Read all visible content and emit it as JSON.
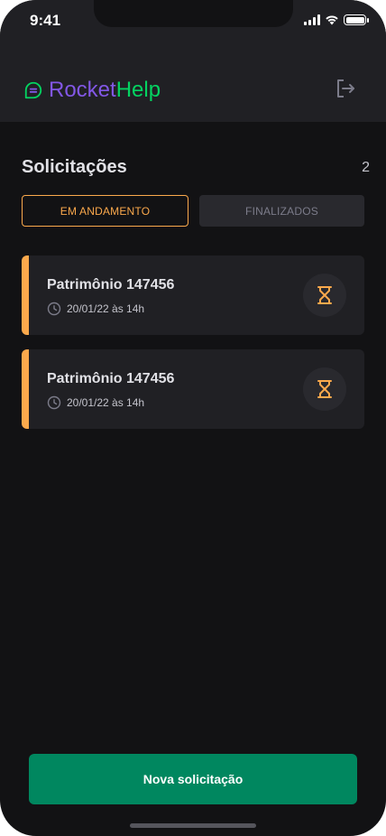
{
  "status_bar": {
    "time": "9:41"
  },
  "header": {
    "logo_part1": "Rocket",
    "logo_part2": "Help",
    "logout_icon": "logout-icon"
  },
  "main": {
    "title": "Solicitações",
    "count": "2",
    "tabs": [
      {
        "label": "EM ANDAMENTO",
        "active": true
      },
      {
        "label": "FINALIZADOS",
        "active": false
      }
    ],
    "orders": [
      {
        "title": "Patrimônio 147456",
        "when": "20/01/22 às 14h",
        "status_icon": "hourglass-icon"
      },
      {
        "title": "Patrimônio 147456",
        "when": "20/01/22 às 14h",
        "status_icon": "hourglass-icon"
      }
    ]
  },
  "footer": {
    "new_button": "Nova solicitação"
  },
  "colors": {
    "background": "#121214",
    "header": "#202024",
    "accent_orange": "#fba94c",
    "brand_purple": "#8257e5",
    "brand_green": "#04d361",
    "button_green": "#00875f"
  }
}
